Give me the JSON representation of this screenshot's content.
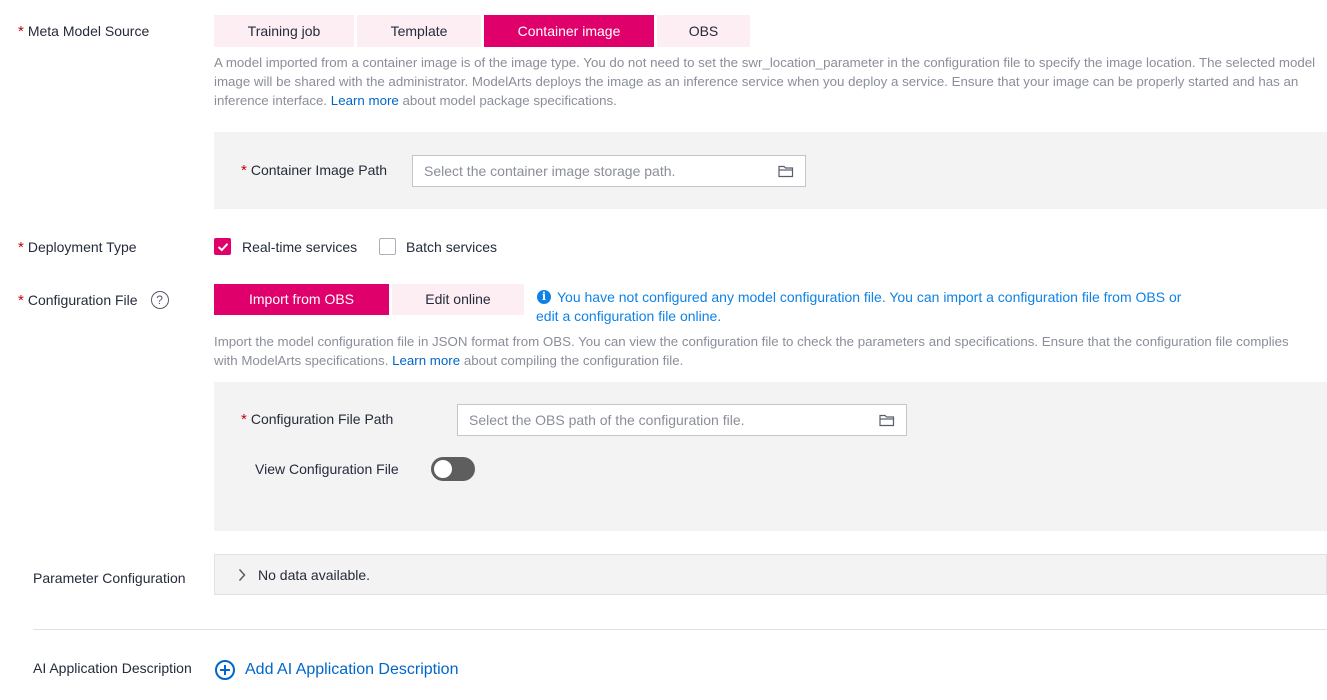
{
  "meta_model_source": {
    "label": "Meta Model Source",
    "options": [
      "Training job",
      "Template",
      "Container image",
      "OBS"
    ],
    "selected": "Container image",
    "description_pre": "A model imported from a container image is of the image type. You do not need to set the swr_location_parameter in the configuration file to specify the image location. The selected model image will be shared with the administrator. ModelArts deploys the image as an inference service when you deploy a service. Ensure that your image can be properly started and has an inference interface.",
    "learn_more": "Learn more",
    "description_post": "about model package specifications.",
    "container_image_path": {
      "label": "Container Image Path",
      "placeholder": "Select the container image storage path.",
      "icon": "folder-icon"
    }
  },
  "deployment_type": {
    "label": "Deployment Type",
    "options": [
      {
        "label": "Real-time services",
        "checked": true
      },
      {
        "label": "Batch services",
        "checked": false
      }
    ]
  },
  "configuration_file": {
    "label": "Configuration File",
    "help_icon": "?",
    "tabs": [
      "Import from OBS",
      "Edit online"
    ],
    "selected": "Import from OBS",
    "info_icon": "i",
    "info_text": "You have not configured any model configuration file. You can import a configuration file from OBS or edit a configuration file online.",
    "description_pre": "Import the model configuration file in JSON format from OBS. You can view the configuration file to check the parameters and specifications. Ensure that the configuration file complies with ModelArts specifications.",
    "learn_more": "Learn more",
    "description_post": "about compiling the configuration file.",
    "path": {
      "label": "Configuration File Path",
      "placeholder": "Select the OBS path of the configuration file.",
      "icon": "folder-icon"
    },
    "view": {
      "label": "View Configuration File",
      "enabled": false
    }
  },
  "parameter_configuration": {
    "label": "Parameter Configuration",
    "empty_text": "No data available."
  },
  "ai_application_description": {
    "label": "AI Application Description",
    "add_label": "Add AI Application Description"
  },
  "colors": {
    "accent": "#e0006b",
    "accent_light": "#fdeef4",
    "link": "#0066cc",
    "info": "#0f82e6",
    "required": "#c7000b"
  }
}
